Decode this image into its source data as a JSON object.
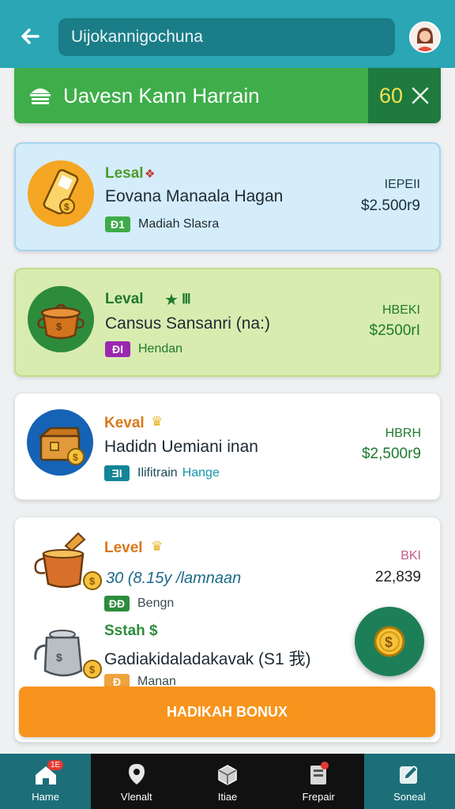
{
  "header": {
    "back_icon": "arrow-left-icon",
    "title": "Uijokannigochuna",
    "avatar_icon": "user-avatar-icon"
  },
  "banner": {
    "icon": "shop-icon",
    "label": "Uavesn Kann Harrain",
    "count": "60",
    "close_icon": "close-icon"
  },
  "cards": [
    {
      "level": "Lesal",
      "name": "Eovana Manaala Hagan",
      "chip": "Ð1",
      "tag": "Madiah Slasra",
      "price_label": "IEPEII",
      "price": "$2.500r9"
    },
    {
      "level": "Leval",
      "name": "Cansus Sansanri (na:)",
      "chip": "ÐI",
      "tag": "Hendan",
      "price_label": "HBEKI",
      "price": "$2500rI"
    },
    {
      "level": "Keval",
      "name": "Hadidn Uemiani inan",
      "chip": "ƎI",
      "tag": "Hange",
      "tag_dark": "Ilifitrain",
      "price_label": "HBRH",
      "price": "$2,500r9"
    }
  ],
  "bottom_card": {
    "level": "Level",
    "value": "30 (8.15y /lamnaan",
    "chip": "ÐÐ",
    "tag": "Bengn",
    "price_label": "BKI",
    "price": "22,839",
    "section_label": "Sstah $",
    "section_name": "Gadiakidaladakavak (S1 我)",
    "section_chip": "Ð",
    "section_tag": "Manan"
  },
  "cta": {
    "label": "HADIKAH BONUX"
  },
  "fab": {
    "icon": "coin-icon"
  },
  "nav": {
    "items": [
      {
        "label": "Hame",
        "icon": "home-icon",
        "badge": "1E"
      },
      {
        "label": "Vlenalt",
        "icon": "location-icon"
      },
      {
        "label": "Itiae",
        "icon": "box-icon"
      },
      {
        "label": "Frepair",
        "icon": "card-icon"
      },
      {
        "label": "Soneal",
        "icon": "edit-icon"
      }
    ]
  },
  "colors": {
    "topbar": "#2aa6b5",
    "banner": "#3fae4a",
    "cta": "#f7941d",
    "fab": "#1d7f58"
  }
}
